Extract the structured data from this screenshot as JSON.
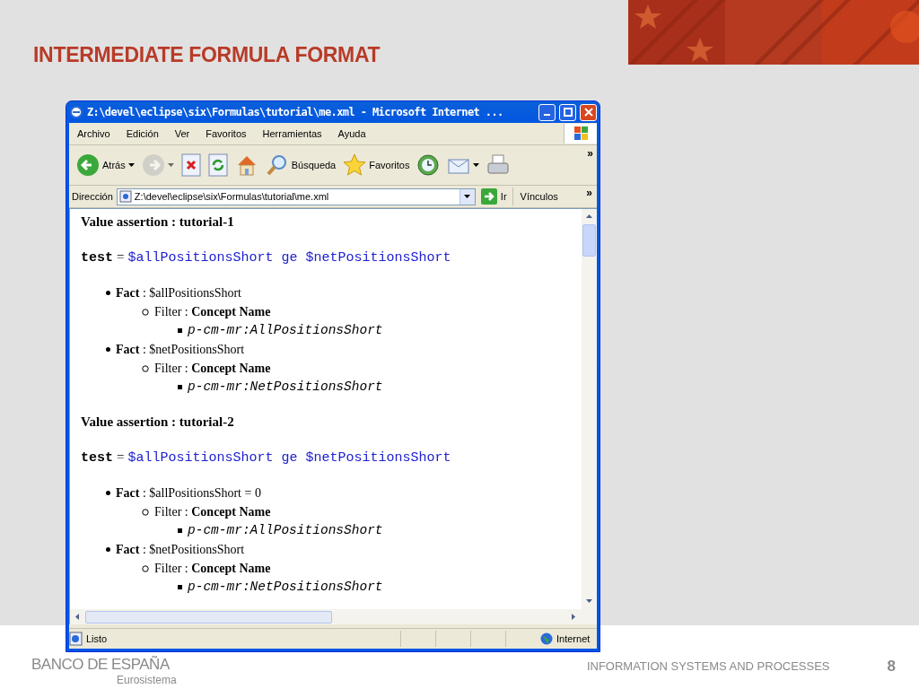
{
  "slide": {
    "title": "INTERMEDIATE FORMULA FORMAT"
  },
  "window": {
    "title": "Z:\\devel\\eclipse\\six\\Formulas\\tutorial\\me.xml - Microsoft Internet ...",
    "menu": [
      "Archivo",
      "Edición",
      "Ver",
      "Favoritos",
      "Herramientas",
      "Ayuda"
    ],
    "toolbar": [
      {
        "kind": "back",
        "label": "Atrás",
        "dropdown": true,
        "disabled": false
      },
      {
        "kind": "forward",
        "dropdown": true,
        "disabled": true
      },
      {
        "kind": "stop",
        "disabled": false
      },
      {
        "kind": "refresh",
        "disabled": false
      },
      {
        "kind": "home",
        "disabled": false
      },
      {
        "kind": "search",
        "label": "Búsqueda",
        "disabled": false
      },
      {
        "kind": "favorites",
        "label": "Favoritos",
        "disabled": false
      },
      {
        "kind": "history",
        "disabled": false
      },
      {
        "kind": "mail",
        "dropdown": true,
        "disabled": false
      },
      {
        "kind": "print",
        "disabled": false
      }
    ],
    "toolbar_more": "»",
    "address": {
      "label": "Dirección",
      "value": "Z:\\devel\\eclipse\\six\\Formulas\\tutorial\\me.xml",
      "go": "Ir",
      "links": "Vínculos",
      "more": "»"
    },
    "content": [
      {
        "heading": "Value assertion : tutorial-1",
        "test": {
          "lhs": "test",
          "op": "=",
          "rhs": "$allPositionsShort ge $netPositionsShort"
        },
        "facts": [
          {
            "text": "**Fact** : $allPositionsShort",
            "children": [
              {
                "text": "Filter : **Concept Name**",
                "children": [
                  {
                    "text": "p-cm-mr:AllPositionsShort"
                  }
                ]
              }
            ]
          },
          {
            "text": "**Fact** : $netPositionsShort",
            "children": [
              {
                "text": "Filter : **Concept Name**",
                "children": [
                  {
                    "text": "p-cm-mr:NetPositionsShort"
                  }
                ]
              }
            ]
          }
        ]
      },
      {
        "heading": "Value assertion : tutorial-2",
        "test": {
          "lhs": "test",
          "op": "=",
          "rhs": "$allPositionsShort ge $netPositionsShort"
        },
        "facts": [
          {
            "text": "**Fact** : $allPositionsShort = 0",
            "children": [
              {
                "text": "Filter : **Concept Name**",
                "children": [
                  {
                    "text": "p-cm-mr:AllPositionsShort"
                  }
                ]
              }
            ]
          },
          {
            "text": "**Fact** : $netPositionsShort",
            "children": [
              {
                "text": "Filter : **Concept Name**",
                "children": [
                  {
                    "text": "p-cm-mr:NetPositionsShort"
                  }
                ]
              }
            ]
          }
        ]
      }
    ],
    "status": {
      "text": "Listo",
      "zone": "Internet"
    }
  },
  "footer": {
    "logo": "BANCO DE ESPAÑA",
    "sublogo": "Eurosistema",
    "section": "INFORMATION SYSTEMS AND PROCESSES",
    "page": "8"
  }
}
